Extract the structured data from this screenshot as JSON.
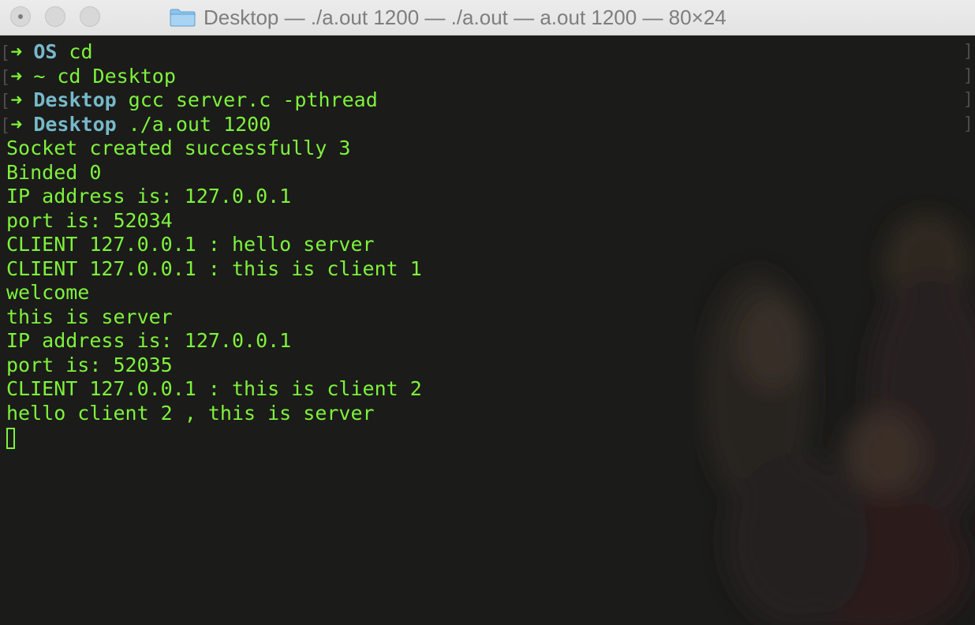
{
  "window": {
    "title": "Desktop — ./a.out 1200 — ./a.out — a.out 1200 — 80×24",
    "folder_icon": "folder-icon"
  },
  "colors": {
    "text": "#7ef23c",
    "prompt_dir": "#76b9ca",
    "background": "#1b1b19"
  },
  "terminal": {
    "prompts": [
      {
        "dir": "OS",
        "cmd": "cd"
      },
      {
        "dir": "~",
        "cmd": "cd Desktop"
      },
      {
        "dir": "Desktop",
        "cmd": "gcc server.c -pthread"
      },
      {
        "dir": "Desktop",
        "cmd": "./a.out 1200"
      }
    ],
    "output": [
      "Socket created successfully 3",
      "Binded 0",
      "IP address is: 127.0.0.1",
      "port is: 52034",
      "CLIENT 127.0.0.1 : hello server",
      "CLIENT 127.0.0.1 : this is client 1",
      "welcome",
      "this is server",
      "IP address is: 127.0.0.1",
      "port is: 52035",
      "CLIENT 127.0.0.1 : this is client 2",
      "hello client 2 , this is server"
    ]
  }
}
